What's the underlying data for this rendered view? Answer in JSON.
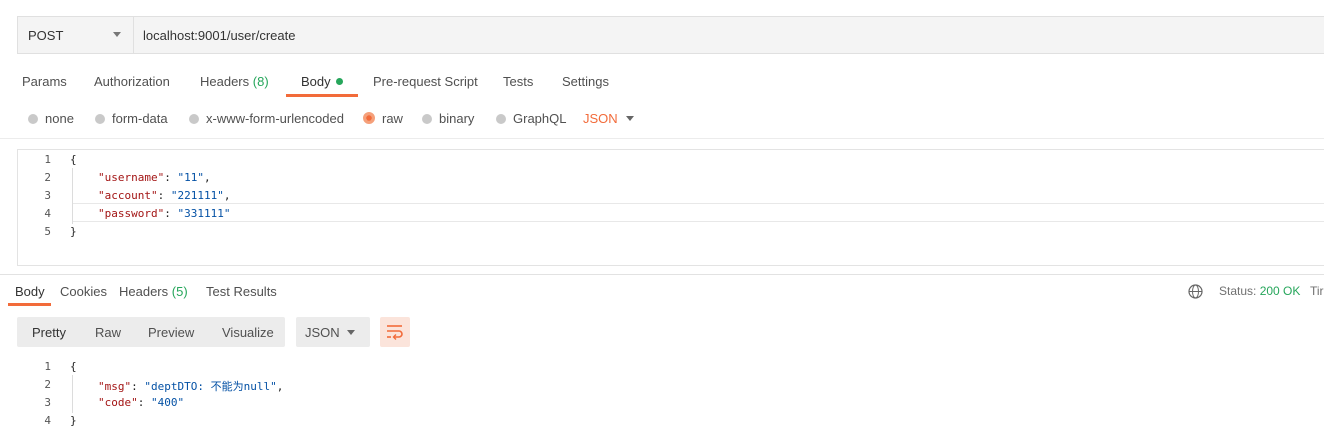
{
  "request": {
    "method": "POST",
    "url": "localhost:9001/user/create"
  },
  "request_tabs": {
    "params": "Params",
    "authorization": "Authorization",
    "headers": "Headers",
    "headers_count": "(8)",
    "body": "Body",
    "prerequest": "Pre-request Script",
    "tests": "Tests",
    "settings": "Settings"
  },
  "body_types": {
    "none": "none",
    "form_data": "form-data",
    "urlencoded": "x-www-form-urlencoded",
    "raw": "raw",
    "binary": "binary",
    "graphql": "GraphQL",
    "format": "JSON",
    "selected": "raw"
  },
  "request_body": {
    "line_numbers": [
      "1",
      "2",
      "3",
      "4",
      "5"
    ],
    "open": "{",
    "close": "}",
    "fields": [
      {
        "key": "\"username\"",
        "value": "\"11\"",
        "suffix": ","
      },
      {
        "key": "\"account\"",
        "value": "\"221111\"",
        "suffix": ","
      },
      {
        "key": "\"password\"",
        "value": "\"331111\"",
        "suffix": ""
      }
    ]
  },
  "response_tabs": {
    "body": "Body",
    "cookies": "Cookies",
    "headers": "Headers",
    "headers_count": "(5)",
    "test_results": "Test Results"
  },
  "response_status": {
    "label": "Status:",
    "value": "200 OK",
    "time_partial": "Tir"
  },
  "response_view": {
    "pretty": "Pretty",
    "raw": "Raw",
    "preview": "Preview",
    "visualize": "Visualize",
    "format": "JSON"
  },
  "response_body": {
    "line_numbers": [
      "1",
      "2",
      "3",
      "4"
    ],
    "open": "{",
    "close": "}",
    "fields": [
      {
        "key": "\"msg\"",
        "value": "\"deptDTO: 不能为null\"",
        "suffix": ","
      },
      {
        "key": "\"code\"",
        "value": "\"400\"",
        "suffix": ""
      }
    ]
  },
  "colors": {
    "accent": "#f26b3a",
    "success": "#26a65b",
    "json_key": "#a31515",
    "json_string": "#0451a5"
  }
}
